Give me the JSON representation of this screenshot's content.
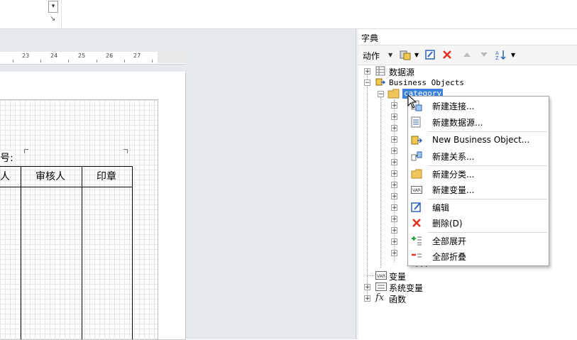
{
  "ruler": {
    "ticks": [
      "23",
      "24",
      "25",
      "26",
      "27"
    ]
  },
  "report": {
    "label_no": "号:",
    "headers": [
      "人",
      "审核人",
      "印章"
    ]
  },
  "dictionary": {
    "title": "字典",
    "toolbar": {
      "action_label": "动作"
    },
    "tree": {
      "datasource": "数据源",
      "business_objects": "Business Objects",
      "category": "category",
      "hidden_partial": "...",
      "variables": "变量",
      "system_variables": "系统变量",
      "functions": "函数",
      "fx_symbol": "fx"
    }
  },
  "context_menu": {
    "items": [
      {
        "label": "新建连接..."
      },
      {
        "label": "新建数据源..."
      },
      {
        "label": "New Business Object..."
      },
      {
        "label": "新建关系..."
      },
      {
        "label": "新建分类..."
      },
      {
        "label": "新建变量..."
      },
      {
        "label": "编辑"
      },
      {
        "label": "删除(D)"
      },
      {
        "label": "全部展开"
      },
      {
        "label": "全部折叠"
      }
    ]
  },
  "colors": {
    "selection": "#3d80df",
    "delete_red": "#e0301e",
    "design_bg": "#e5e8ec"
  }
}
